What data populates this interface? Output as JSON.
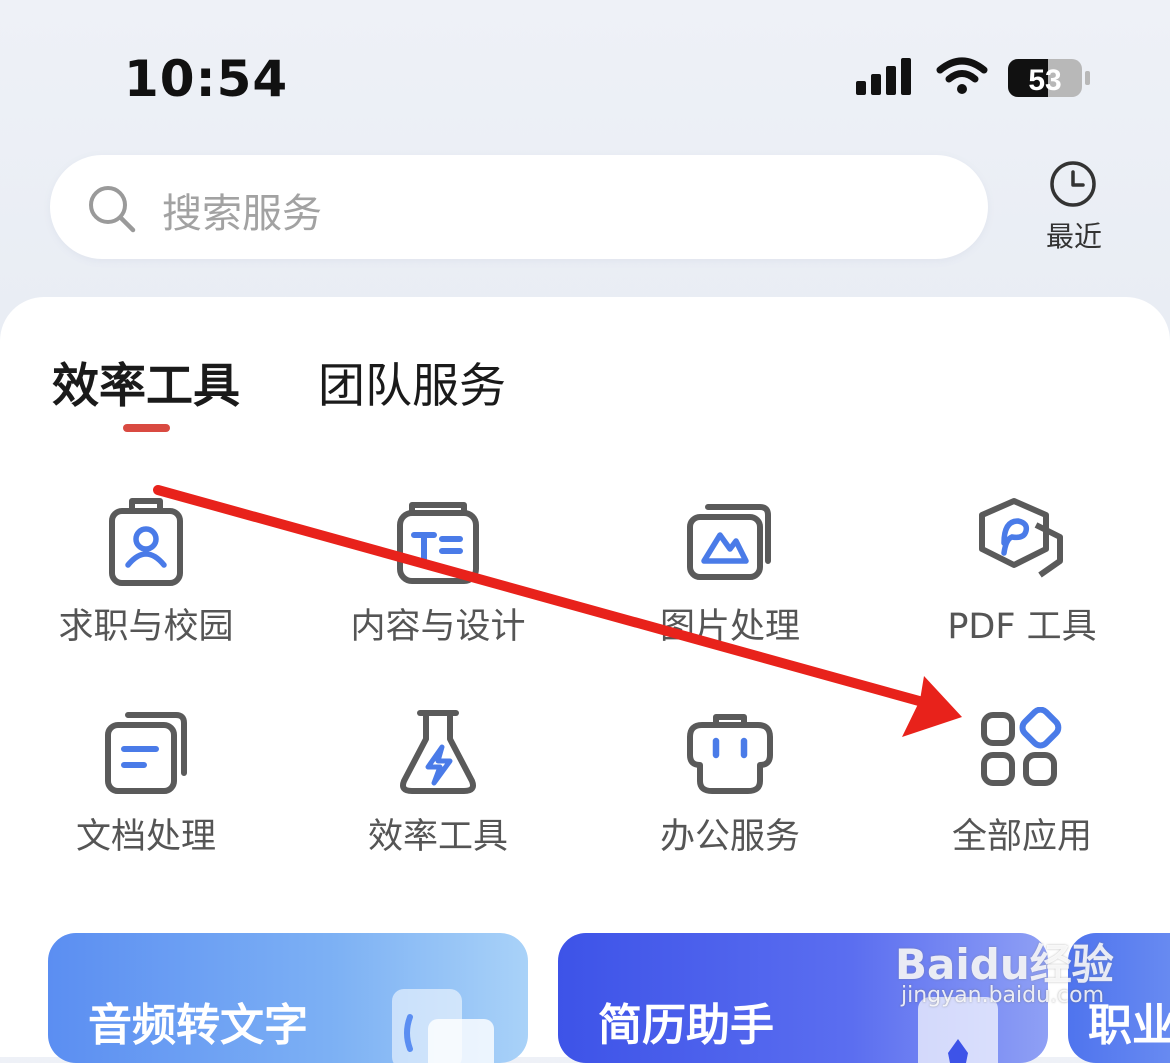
{
  "status_bar": {
    "time": "10:54",
    "battery_level": "53",
    "icons": [
      "cellular-signal-icon",
      "wifi-icon",
      "battery-icon"
    ]
  },
  "search": {
    "placeholder": "搜索服务",
    "icon": "search-icon"
  },
  "recent": {
    "label": "最近",
    "icon": "clock-icon"
  },
  "tabs": [
    {
      "label": "效率工具",
      "active": true
    },
    {
      "label": "团队服务",
      "active": false
    }
  ],
  "grid": [
    {
      "label": "求职与校园",
      "icon": "id-badge-icon"
    },
    {
      "label": "内容与设计",
      "icon": "text-design-icon"
    },
    {
      "label": "图片处理",
      "icon": "image-stack-icon"
    },
    {
      "label": "PDF 工具",
      "icon": "pdf-hexagon-icon"
    },
    {
      "label": "文档处理",
      "icon": "document-stack-icon"
    },
    {
      "label": "效率工具",
      "icon": "flask-bolt-icon"
    },
    {
      "label": "办公服务",
      "icon": "briefcase-icon"
    },
    {
      "label": "全部应用",
      "icon": "all-apps-grid-icon"
    }
  ],
  "cards": [
    {
      "title": "音频转文字",
      "icon": "audio-to-text-icon"
    },
    {
      "title": "简历助手",
      "icon": "resume-icon"
    },
    {
      "title": "职业",
      "icon": "career-icon"
    }
  ],
  "watermark": {
    "brand": "Baidu经验",
    "url": "jingyan.baidu.com"
  },
  "colors": {
    "accent": "#d94a41",
    "icon_blue": "#4a7be8",
    "icon_gray": "#5a5a5a",
    "arrow": "#e8221b"
  }
}
